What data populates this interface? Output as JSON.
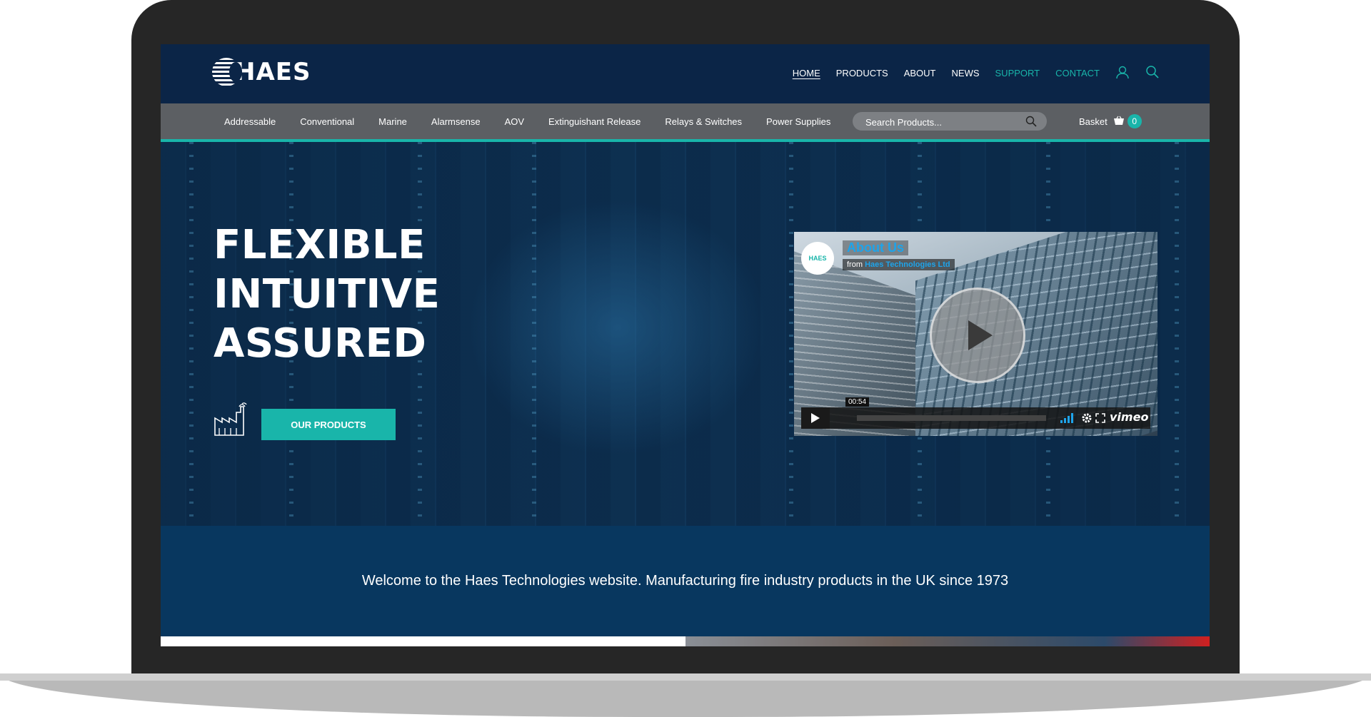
{
  "header": {
    "logo_text": "HAES",
    "nav": [
      {
        "label": "HOME",
        "state": "active"
      },
      {
        "label": "PRODUCTS",
        "state": "normal"
      },
      {
        "label": "ABOUT",
        "state": "normal"
      },
      {
        "label": "NEWS",
        "state": "normal"
      },
      {
        "label": "SUPPORT",
        "state": "accent"
      },
      {
        "label": "CONTACT",
        "state": "accent"
      }
    ],
    "icons": [
      "user-icon",
      "search-icon"
    ]
  },
  "categories": [
    "Addressable",
    "Conventional",
    "Marine",
    "Alarmsense",
    "AOV",
    "Extinguishant Release",
    "Relays & Switches",
    "Power Supplies"
  ],
  "search": {
    "placeholder": "Search Products..."
  },
  "basket": {
    "label": "Basket",
    "count": "0"
  },
  "hero": {
    "title_lines": [
      "FLEXIBLE",
      "INTUITIVE",
      "ASSURED"
    ],
    "cta_label": "OUR PRODUCTS",
    "cta_icon": "factory-icon"
  },
  "video": {
    "avatar_text": "HAES",
    "title": "About Us",
    "from_label": "from",
    "channel": "Haes Technologies Ltd",
    "timecode": "00:54",
    "progress": 0.0,
    "brand": "vimeo"
  },
  "welcome": {
    "text": "Welcome to the Haes Technologies website. Manufacturing fire industry products in the UK since 1973"
  },
  "colors": {
    "accent": "#19b5aa",
    "header_bg": "#0b2547",
    "catbar_bg": "#5c5f63",
    "welcome_bg": "#08375f",
    "video_title": "#1ea4ea"
  }
}
